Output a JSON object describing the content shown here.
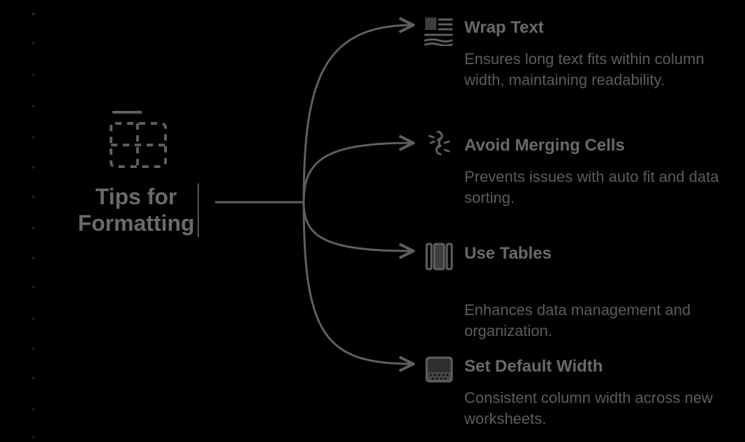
{
  "root": {
    "title_line1": "Tips for",
    "title_line2": "Formatting"
  },
  "branches": [
    {
      "icon": "wrap-text-icon",
      "title": "Wrap Text",
      "desc": "Ensures long text fits within column width, maintaining readability."
    },
    {
      "icon": "broken-link-icon",
      "title": "Avoid Merging Cells",
      "desc": "Prevents issues with auto fit and data sorting."
    },
    {
      "icon": "columns-icon",
      "title": "Use Tables",
      "desc": "Enhances data management and organization."
    },
    {
      "icon": "container-icon",
      "title": "Set Default Width",
      "desc": "Consistent column width across new worksheets."
    }
  ],
  "colors": {
    "text_heading": "#6a6a6a",
    "text_body": "#5c5c5c",
    "stroke": "#5f5f5f"
  }
}
